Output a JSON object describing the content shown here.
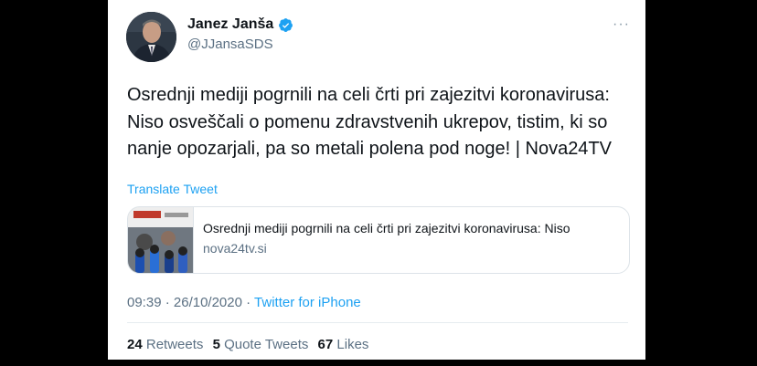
{
  "author": {
    "name": "Janez Janša",
    "handle": "@JJansaSDS",
    "verified_icon": "verified-badge-icon",
    "avatar_icon": "profile-photo"
  },
  "tweet": {
    "text": "Osrednji mediji pogrnili na celi črti pri zajezitvi koronavirusa: Niso osveščali o pomenu zdravstvenih ukrepov, tistim, ki so nanje opozarjali, pa so metali polena pod noge! | Nova24TV",
    "translate_label": "Translate Tweet",
    "more_icon": "more-options-icon"
  },
  "link_card": {
    "title": "Osrednji mediji pogrnili na celi črti pri zajezitvi koronavirusa: Niso",
    "domain": "nova24tv.si"
  },
  "meta": {
    "time": "09:39",
    "separator": " · ",
    "date": "26/10/2020",
    "source": "Twitter for iPhone"
  },
  "stats": {
    "retweets_count": "24",
    "retweets_label": "Retweets",
    "quotes_count": "5",
    "quotes_label": "Quote Tweets",
    "likes_count": "67",
    "likes_label": "Likes"
  },
  "colors": {
    "accent": "#1da1f2",
    "text": "#0f1419",
    "secondary": "#5b7083",
    "background_outer": "#000000"
  }
}
